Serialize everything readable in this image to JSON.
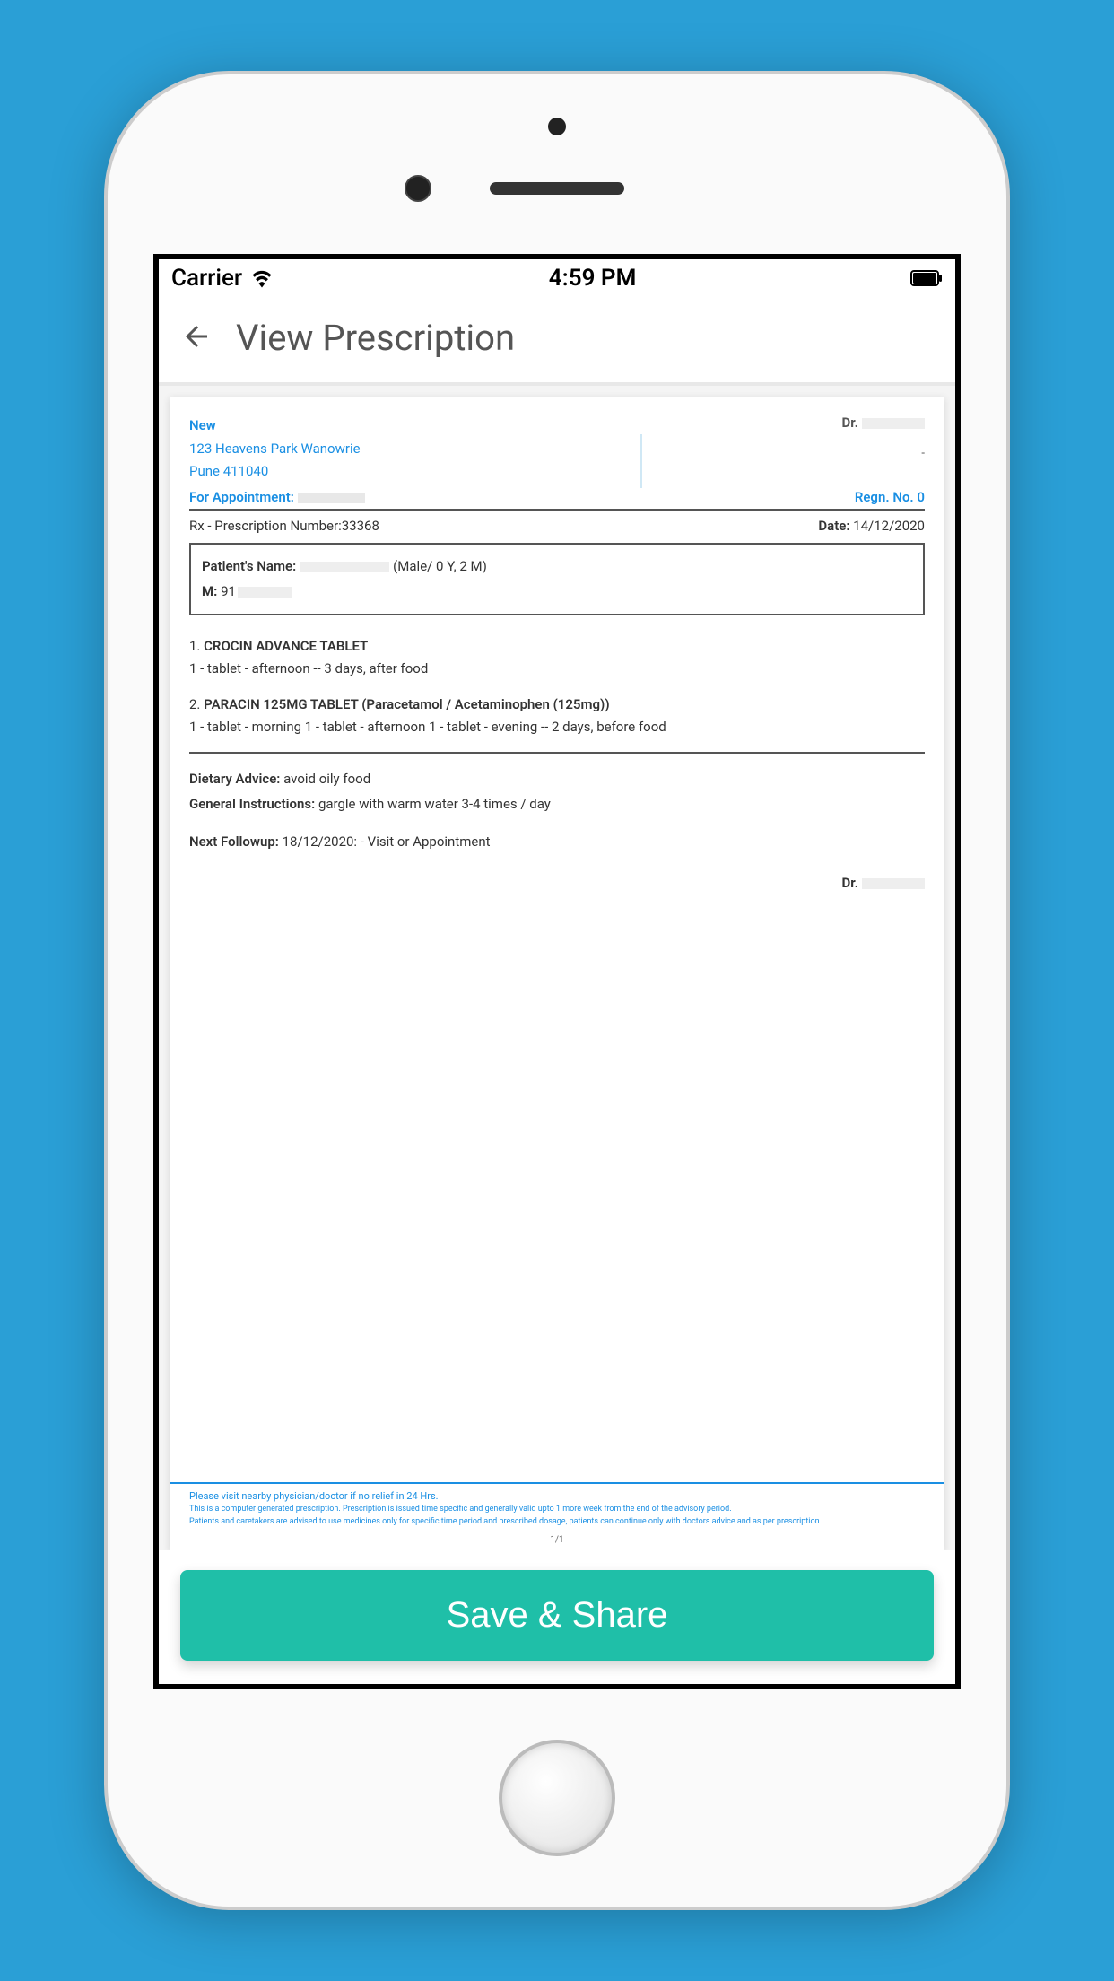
{
  "statusbar": {
    "carrier": "Carrier",
    "time": "4:59 PM"
  },
  "header": {
    "title": "View Prescription"
  },
  "document": {
    "clinic": {
      "status": "New",
      "address1": "123 Heavens Park Wanowrie",
      "address2": "Pune 411040",
      "appointment_label": "For Appointment:"
    },
    "doctor": {
      "prefix": "Dr.",
      "regn": "Regn. No. 0"
    },
    "rx": {
      "number_label": "Rx - Prescription Number:",
      "number": "33368",
      "date_label": "Date:",
      "date": "14/12/2020"
    },
    "patient": {
      "name_label": "Patient's Name:",
      "demographics": "(Male/ 0 Y, 2 M)",
      "mobile_label": "M:",
      "mobile_prefix": "91"
    },
    "meds": [
      {
        "index": "1.",
        "name": "CROCIN ADVANCE TABLET",
        "dosage": "1 - tablet - afternoon -- 3 days, after food"
      },
      {
        "index": "2.",
        "name": "PARACIN 125MG TABLET (Paracetamol / Acetaminophen (125mg))",
        "dosage": "1 - tablet - morning 1 - tablet - afternoon 1 - tablet - evening -- 2 days, before food"
      }
    ],
    "dietary": {
      "label": "Dietary Advice:",
      "text": "avoid oily food"
    },
    "instructions": {
      "label": "General Instructions:",
      "text": "gargle with warm water 3-4 times / day"
    },
    "followup": {
      "label": "Next Followup:",
      "text": "18/12/2020: - Visit or Appointment"
    },
    "signature": "Dr.",
    "footer": {
      "line1": "Please visit nearby physician/doctor if no relief in 24 Hrs.",
      "line2": "This is a computer generated prescription. Prescription is issued time specific and generally valid upto 1 more week from the end of the advisory period.",
      "line3": "Patients and caretakers are advised to use medicines only for specific time period and prescribed dosage, patients can continue only with doctors advice and as per prescription.",
      "page": "1/1"
    }
  },
  "actions": {
    "save_share": "Save & Share"
  }
}
